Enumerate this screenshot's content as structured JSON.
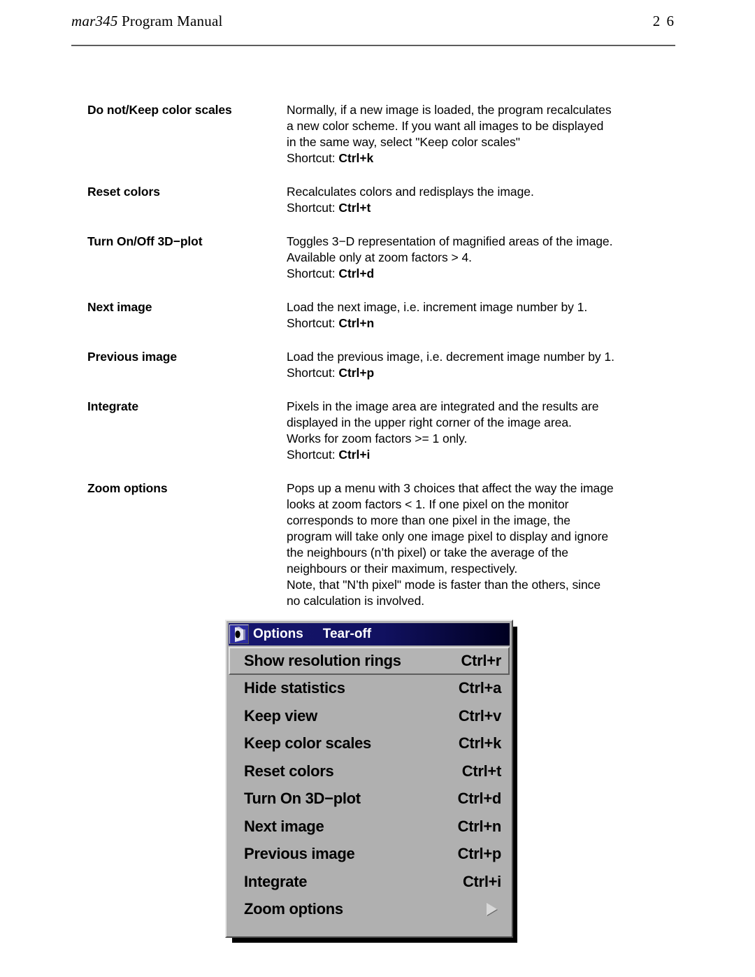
{
  "header": {
    "manual_name": "mar345",
    "title_rest": " Program Manual",
    "page_number": "2 6"
  },
  "entries": [
    {
      "term": "Do not/Keep color scales",
      "lines": [
        "Normally, if a new image is loaded, the program recalculates",
        "a new color scheme. If you want all images to be displayed",
        "in the same way, select \"Keep color scales\""
      ],
      "shortcut_label": "Shortcut: ",
      "shortcut_key": "Ctrl+k"
    },
    {
      "term": "Reset colors",
      "lines": [
        "Recalculates colors and redisplays the image."
      ],
      "shortcut_label": "Shortcut: ",
      "shortcut_key": "Ctrl+t"
    },
    {
      "term": "Turn On/Off 3D−plot",
      "lines": [
        "Toggles 3−D representation of magnified areas of the image.",
        "Available only at zoom factors > 4."
      ],
      "shortcut_label": "Shortcut: ",
      "shortcut_key": "Ctrl+d"
    },
    {
      "term": "Next image",
      "lines": [
        "Load the next image, i.e. increment image number by 1."
      ],
      "shortcut_label": "Shortcut: ",
      "shortcut_key": "Ctrl+n"
    },
    {
      "term": "Previous image",
      "lines": [
        "Load the previous image, i.e. decrement image number by 1."
      ],
      "shortcut_label": "Shortcut: ",
      "shortcut_key": "Ctrl+p"
    },
    {
      "term": "Integrate",
      "lines": [
        "Pixels in the image area are integrated and the results are",
        "displayed in the upper right corner of the image area.",
        "Works for zoom factors >= 1 only."
      ],
      "shortcut_label": "Shortcut: ",
      "shortcut_key": "Ctrl+i"
    },
    {
      "term": "Zoom options",
      "lines": [
        "Pops up a menu with 3 choices that affect the way the image",
        "looks at zoom factors < 1. If one pixel on the monitor",
        "corresponds to more than one pixel in the image, the",
        "program will take only one image pixel to display and ignore",
        "the neighbours (n’th pixel) or take the average of the",
        "neighbours or their maximum, respectively.",
        "Note, that \"N’th pixel\" mode is faster than the others, since",
        "no calculation is involved."
      ],
      "shortcut_label": "",
      "shortcut_key": ""
    }
  ],
  "menu_widget": {
    "icon_name": "mar345-app-icon",
    "titlebar": {
      "options_label": "Options",
      "tearoff_label": "Tear-off"
    },
    "items": [
      {
        "label": "Show resolution rings",
        "accel": "Ctrl+r",
        "selected": true,
        "submenu": false
      },
      {
        "label": "Hide statistics",
        "accel": "Ctrl+a",
        "selected": false,
        "submenu": false
      },
      {
        "label": "Keep view",
        "accel": "Ctrl+v",
        "selected": false,
        "submenu": false
      },
      {
        "label": "Keep color scales",
        "accel": "Ctrl+k",
        "selected": false,
        "submenu": false
      },
      {
        "label": "Reset colors",
        "accel": "Ctrl+t",
        "selected": false,
        "submenu": false
      },
      {
        "label": "Turn On 3D−plot",
        "accel": "Ctrl+d",
        "selected": false,
        "submenu": false
      },
      {
        "label": "Next image",
        "accel": "Ctrl+n",
        "selected": false,
        "submenu": false
      },
      {
        "label": "Previous image",
        "accel": "Ctrl+p",
        "selected": false,
        "submenu": false
      },
      {
        "label": "Integrate",
        "accel": "Ctrl+i",
        "selected": false,
        "submenu": false
      },
      {
        "label": "Zoom options",
        "accel": "",
        "selected": false,
        "submenu": true
      }
    ]
  },
  "colors": {
    "titlebar_navy": "#16166e",
    "menu_face": "#b0b0b0",
    "rule_gray": "#5d5d5d"
  }
}
